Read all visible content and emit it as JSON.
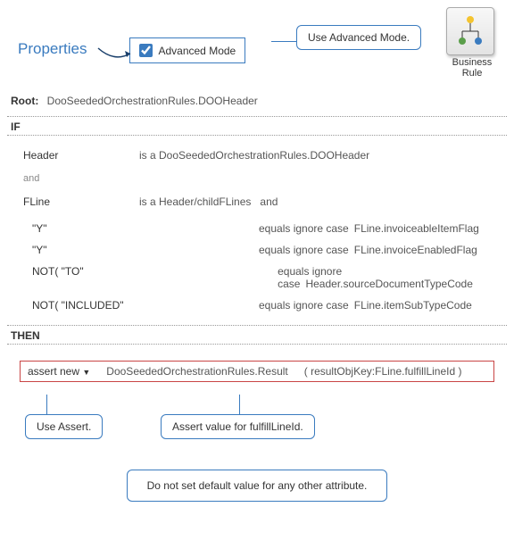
{
  "header": {
    "properties_label": "Properties",
    "advanced_mode_label": "Advanced Mode",
    "advanced_mode_checked": true,
    "callout_advanced": "Use Advanced Mode.",
    "business_rule_label": "Business Rule"
  },
  "root": {
    "label": "Root:",
    "value": "DooSeededOrchestrationRules.DOOHeader"
  },
  "if": {
    "label": "IF",
    "conditions": {
      "header": {
        "subject": "Header",
        "predicate": "is a DooSeededOrchestrationRules.DOOHeader"
      },
      "and": "and",
      "fline": {
        "subject": "FLine",
        "predicate": "is a Header/childFLines",
        "trail": "and"
      },
      "sub": [
        {
          "left": "\"Y\"",
          "op": "equals ignore case",
          "right": "FLine.invoiceableItemFlag"
        },
        {
          "left": "\"Y\"",
          "op": "equals ignore case",
          "right": "FLine.invoiceEnabledFlag"
        },
        {
          "left": "NOT(  \"TO\"",
          "op": "equals ignore case",
          "right": "Header.sourceDocumentTypeCode"
        },
        {
          "left": "NOT(  \"INCLUDED\"",
          "op": "equals ignore case",
          "right": "FLine.itemSubTypeCode"
        }
      ]
    }
  },
  "then": {
    "label": "THEN",
    "assert_label": "assert new",
    "assert_class": "DooSeededOrchestrationRules.Result",
    "assert_args": "( resultObjKey:FLine.fulfillLineId )"
  },
  "callouts": {
    "use_assert": "Use Assert.",
    "fulfill": "Assert value  for fulfillLineId.",
    "bottom": "Do not set default value  for any other attribute."
  }
}
